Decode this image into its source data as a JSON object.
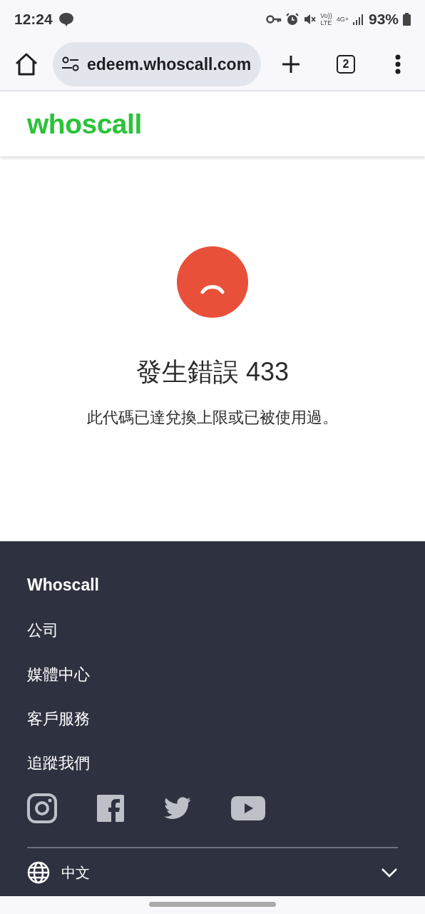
{
  "status_bar": {
    "time": "12:24",
    "network_labels": [
      "Vo))",
      "LTE",
      "4G+"
    ],
    "battery": "93%"
  },
  "browser": {
    "url": "edeem.whoscall.com",
    "tab_count": "2"
  },
  "header": {
    "logo": "whoscall"
  },
  "error": {
    "title": "發生錯誤 433",
    "message": "此代碼已達兌換上限或已被使用過。"
  },
  "footer": {
    "heading": "Whoscall",
    "links": [
      "公司",
      "媒體中心",
      "客戶服務"
    ],
    "follow_label": "追蹤我們",
    "social": [
      {
        "kind": "instagram"
      },
      {
        "kind": "facebook"
      },
      {
        "kind": "twitter"
      },
      {
        "kind": "youtube"
      }
    ],
    "language": "中文"
  }
}
